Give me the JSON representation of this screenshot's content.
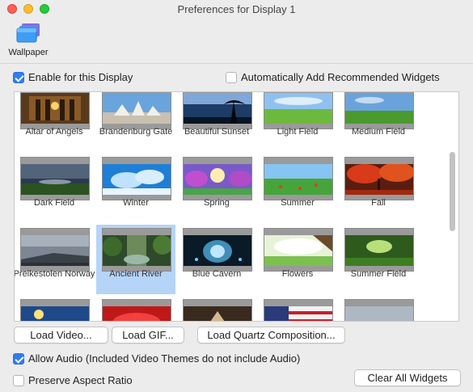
{
  "window": {
    "title": "Preferences for Display 1"
  },
  "toolbar": {
    "wallpaper_label": "Wallpaper",
    "icon": "wallpaper-icon"
  },
  "options": {
    "enable_label": "Enable for this Display",
    "enable_checked": true,
    "auto_widgets_label": "Automatically Add Recommended Widgets",
    "auto_widgets_checked": false
  },
  "wallpapers": [
    {
      "label": "Altar of Angels"
    },
    {
      "label": "Brandenburg Gate"
    },
    {
      "label": "Beautiful Sunset"
    },
    {
      "label": "Light Field"
    },
    {
      "label": "Medium Field"
    },
    {
      "label": "Dark Field"
    },
    {
      "label": "Winter"
    },
    {
      "label": "Spring"
    },
    {
      "label": "Summer"
    },
    {
      "label": "Fall"
    },
    {
      "label": "Preikestolen Norway"
    },
    {
      "label": "Ancient River",
      "selected": true
    },
    {
      "label": "Blue Cavern"
    },
    {
      "label": "Flowers"
    },
    {
      "label": "Summer Field"
    },
    {
      "label": ""
    },
    {
      "label": ""
    },
    {
      "label": ""
    },
    {
      "label": ""
    },
    {
      "label": ""
    }
  ],
  "buttons": {
    "load_video": "Load Video...",
    "load_gif": "Load GIF...",
    "load_quartz": "Load Quartz Composition...",
    "clear_widgets": "Clear All Widgets"
  },
  "bottom_options": {
    "allow_audio_label": "Allow Audio (Included Video Themes do not include Audio)",
    "allow_audio_checked": true,
    "preserve_label": "Preserve Aspect Ratio",
    "preserve_checked": false
  },
  "colors": {
    "accent": "#2f7cf6",
    "selection": "#b5d4f7"
  }
}
